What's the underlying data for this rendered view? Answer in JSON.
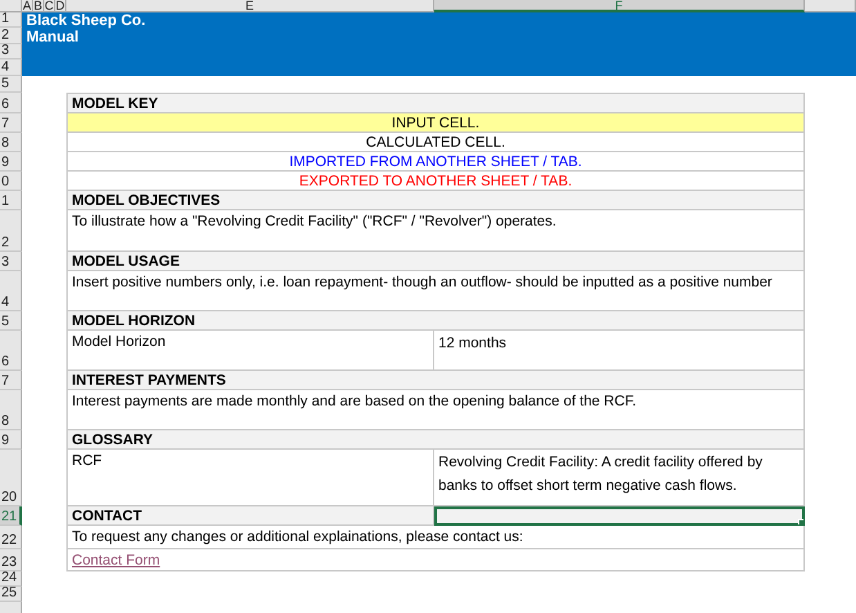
{
  "columns": [
    {
      "label": "A",
      "selected": false
    },
    {
      "label": "B",
      "selected": false
    },
    {
      "label": "C",
      "selected": false
    },
    {
      "label": "D",
      "selected": false
    },
    {
      "label": "E",
      "selected": false
    },
    {
      "label": "F",
      "selected": true
    }
  ],
  "rows": [
    {
      "label": "1",
      "selected": false
    },
    {
      "label": "2",
      "selected": false
    },
    {
      "label": "3",
      "selected": false
    },
    {
      "label": "4",
      "selected": false
    },
    {
      "label": "5",
      "selected": false
    },
    {
      "label": "6",
      "selected": false
    },
    {
      "label": "7",
      "selected": false
    },
    {
      "label": "8",
      "selected": false
    },
    {
      "label": "9",
      "selected": false
    },
    {
      "label": "0",
      "selected": false
    },
    {
      "label": "1",
      "selected": false
    },
    {
      "label": "2",
      "selected": false
    },
    {
      "label": "3",
      "selected": false
    },
    {
      "label": "4",
      "selected": false
    },
    {
      "label": "5",
      "selected": false
    },
    {
      "label": "6",
      "selected": false
    },
    {
      "label": "7",
      "selected": false
    },
    {
      "label": "8",
      "selected": false
    },
    {
      "label": "9",
      "selected": false
    },
    {
      "label": "20",
      "selected": false
    },
    {
      "label": "21",
      "selected": true
    },
    {
      "label": "22",
      "selected": false
    },
    {
      "label": "23",
      "selected": false
    },
    {
      "label": "24",
      "selected": false
    },
    {
      "label": "25",
      "selected": false
    }
  ],
  "banner": {
    "title": "Black Sheep Co.",
    "subtitle": "Manual"
  },
  "sections": [
    {
      "kind": "key",
      "heading": "MODEL KEY",
      "entries": [
        {
          "label": "INPUT CELL.",
          "kind": "input"
        },
        {
          "label": "CALCULATED CELL.",
          "kind": "calculated"
        },
        {
          "label": "IMPORTED FROM ANOTHER SHEET / TAB.",
          "kind": "imported"
        },
        {
          "label": "EXPORTED TO ANOTHER SHEET / TAB.",
          "kind": "exported"
        }
      ]
    },
    {
      "kind": "text",
      "heading": "MODEL OBJECTIVES",
      "text": "To illustrate how a \"Revolving Credit Facility\" (\"RCF\" / \"Revolver\") operates."
    },
    {
      "kind": "text",
      "heading": "MODEL USAGE",
      "text": "Insert positive numbers only, i.e. loan repayment- though an outflow- should be inputted as a positive number"
    },
    {
      "kind": "pair",
      "heading": "MODEL HORIZON",
      "label": "Model Horizon",
      "value": "12 months"
    },
    {
      "kind": "text",
      "heading": "INTEREST PAYMENTS",
      "text": "Interest payments are made monthly and are based on the opening balance of the RCF."
    },
    {
      "kind": "pair",
      "heading": "GLOSSARY",
      "label": "RCF",
      "value": "Revolving Credit Facility: A credit facility offered by banks to offset short term negative cash flows."
    },
    {
      "kind": "contact",
      "heading": "CONTACT",
      "value_cell_selected": true,
      "text": "To request any changes or additional explainations, please contact us:",
      "link": "Contact Form"
    }
  ]
}
